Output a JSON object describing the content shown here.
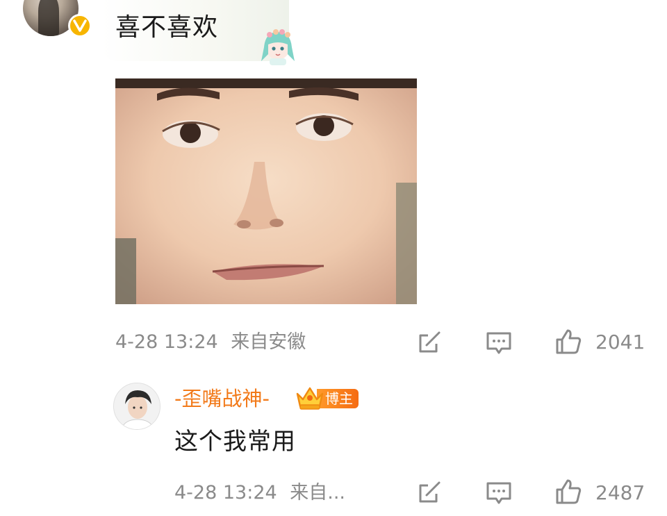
{
  "comment": {
    "text": "喜不喜欢",
    "avatar_icon": "avatar-photo",
    "verified_icon": "verified-v-icon",
    "badge_color": "#f7b500",
    "image": "meme-face-photo",
    "meta": {
      "time": "4-28 13:24",
      "location": "来自安徽"
    },
    "actions": {
      "share_icon": "share-edit-icon",
      "reply_icon": "comment-icon",
      "like_icon": "thumbs-up-icon",
      "like_count": "2041"
    }
  },
  "reply": {
    "avatar_icon": "avatar-photo",
    "name": "-歪嘴战神-",
    "name_color": "#f27a1a",
    "crown_icon": "crown-icon",
    "badge": "博主",
    "text": "这个我常用",
    "meta": {
      "time": "4-28 13:24",
      "location": "来自..."
    },
    "actions": {
      "share_icon": "share-edit-icon",
      "reply_icon": "comment-icon",
      "like_icon": "thumbs-up-icon",
      "like_count": "2487"
    }
  }
}
